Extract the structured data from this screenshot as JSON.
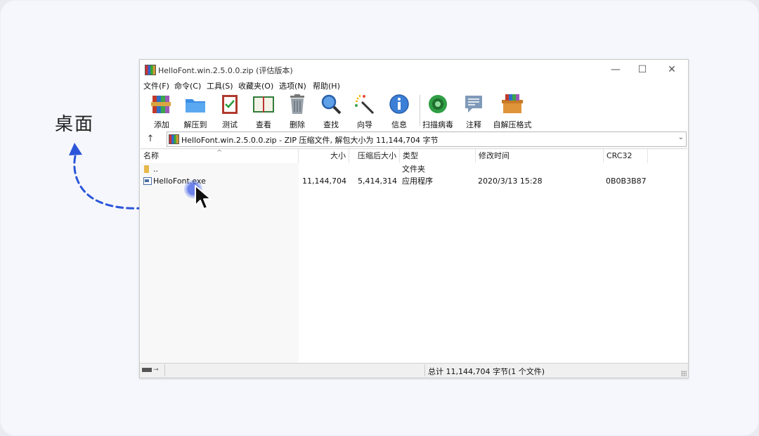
{
  "annotation": {
    "desktop_label": "桌面",
    "arrow_color": "#2b55d9"
  },
  "window": {
    "title": "HelloFont.win.2.5.0.0.zip (评估版本)",
    "controls": {
      "minimize": "—",
      "maximize": "☐",
      "close": "✕"
    }
  },
  "menu": [
    "文件(F)",
    "命令(C)",
    "工具(S)",
    "收藏夹(O)",
    "选项(N)",
    "帮助(H)"
  ],
  "toolbar": [
    {
      "label": "添加",
      "icon": "books-add-icon"
    },
    {
      "label": "解压到",
      "icon": "folder-extract-icon"
    },
    {
      "label": "测试",
      "icon": "clipboard-check-icon"
    },
    {
      "label": "查看",
      "icon": "open-book-icon"
    },
    {
      "label": "删除",
      "icon": "trash-icon"
    },
    {
      "label": "查找",
      "icon": "magnifier-icon"
    },
    {
      "label": "向导",
      "icon": "magic-wand-icon"
    },
    {
      "label": "信息",
      "icon": "info-icon"
    },
    {
      "label": "扫描病毒",
      "icon": "virus-scan-icon"
    },
    {
      "label": "注释",
      "icon": "comment-icon"
    },
    {
      "label": "自解压格式",
      "icon": "sfx-box-icon"
    }
  ],
  "address": {
    "up": "↑",
    "text": "HelloFont.win.2.5.0.0.zip - ZIP 压缩文件, 解包大小为 11,144,704 字节",
    "dropdown": "⌄"
  },
  "columns": {
    "name": "名称",
    "size": "大小",
    "packed": "压缩后大小",
    "type": "类型",
    "modified": "修改时间",
    "crc": "CRC32"
  },
  "files": [
    {
      "name": "..",
      "size": "",
      "packed": "",
      "type": "文件夹",
      "modified": "",
      "crc": ""
    },
    {
      "name": "HelloFont.exe",
      "size": "11,144,704",
      "packed": "5,414,314",
      "type": "应用程序",
      "modified": "2020/3/13 15:28",
      "crc": "0B0B3B87"
    }
  ],
  "status": {
    "summary": "总计 11,144,704 字节(1 个文件)"
  }
}
